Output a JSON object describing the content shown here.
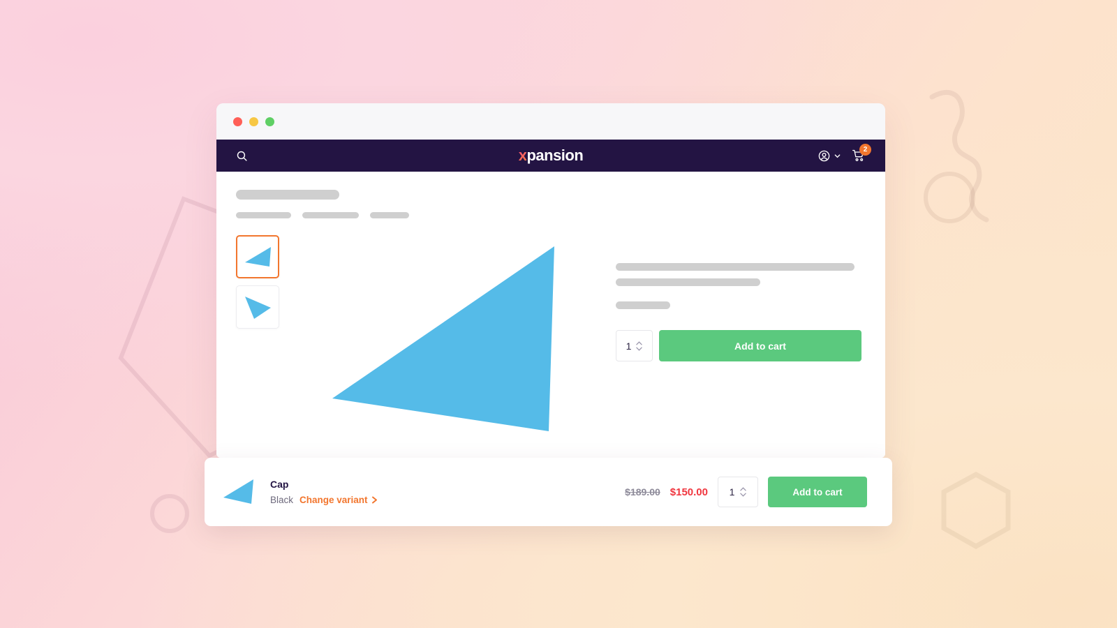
{
  "window": {
    "traffic_lights": [
      "close",
      "minimize",
      "maximize"
    ]
  },
  "nav": {
    "search_icon": "search-icon",
    "logo_accent": "x",
    "logo_text": "pansion",
    "account_icon": "user-circle-icon",
    "account_chevron": "chevron-down-icon",
    "cart_icon": "shopping-cart-icon",
    "cart_count": "2"
  },
  "colors": {
    "nav_bg": "#231443",
    "accent_orange": "#f2762e",
    "cart_green": "#5bc97e",
    "price_red": "#f0363f",
    "skeleton_gray": "#cfcfcf",
    "logo_gradient_start": "#f0477f",
    "logo_gradient_end": "#f97f3d",
    "thumb_image_blue": "#55bbe8"
  },
  "gallery": {
    "thumbnails": [
      {
        "name": "thumbnail-1",
        "selected": true,
        "image": "triangle-left-placeholder"
      },
      {
        "name": "thumbnail-2",
        "selected": false,
        "image": "triangle-right-placeholder"
      }
    ],
    "hero_image": "triangle-placeholder"
  },
  "product_panel": {
    "skeleton_lines": [
      "line-long",
      "line-medium",
      "line-short"
    ],
    "quantity": "1",
    "stepper_up_icon": "chevron-up-icon",
    "stepper_down_icon": "chevron-down-icon",
    "add_to_cart_label": "Add to cart"
  },
  "sticky_bar": {
    "thumbnail": "triangle-placeholder",
    "product_name": "Cap",
    "variant_label": "Black",
    "change_variant_label": "Change variant",
    "change_variant_icon": "chevron-right-icon",
    "price_old": "$189.00",
    "price_new": "$150.00",
    "quantity": "1",
    "stepper_up_icon": "chevron-up-icon",
    "stepper_down_icon": "chevron-down-icon",
    "add_to_cart_label": "Add to cart"
  }
}
